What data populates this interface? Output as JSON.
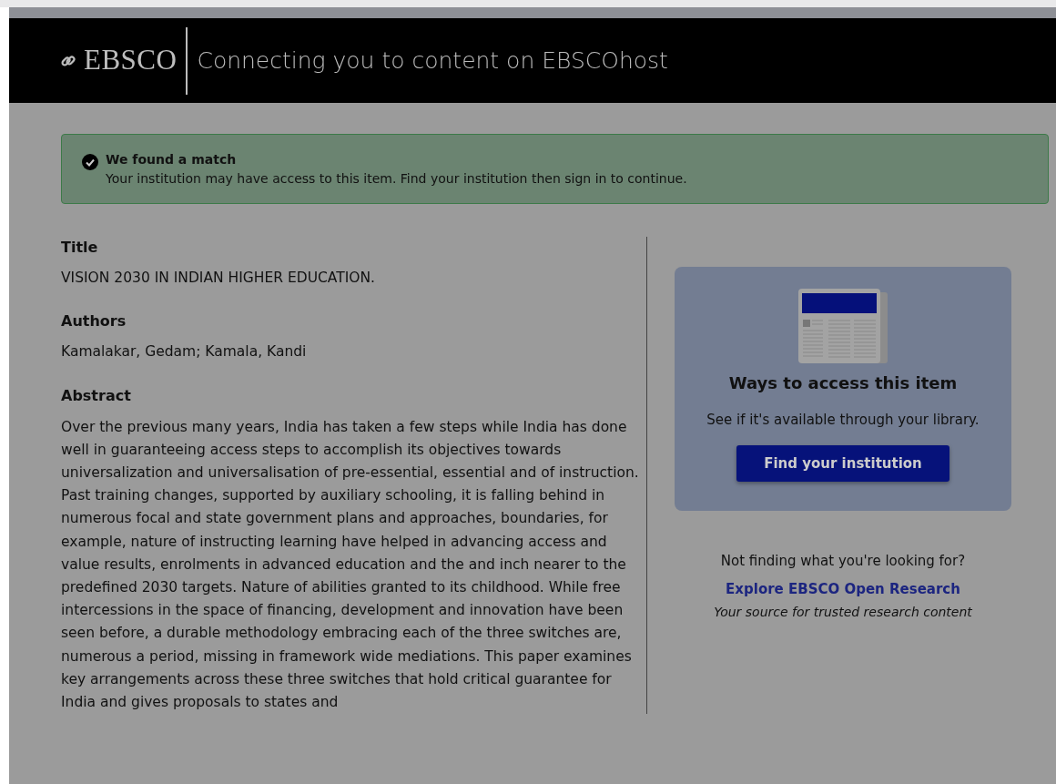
{
  "header": {
    "logo": "EBSCO",
    "title": "Connecting you to content on EBSCOhost"
  },
  "alert": {
    "heading": "We found a match",
    "message": "Your institution may have access to this item. Find your institution then sign in to continue."
  },
  "record": [
    {
      "label": "Title",
      "value": "VISION 2030 IN INDIAN HIGHER EDUCATION."
    },
    {
      "label": "Authors",
      "value": "Kamalakar, Gedam; Kamala, Kandi"
    },
    {
      "label": "Abstract",
      "value": "Over the previous many years, India has taken a few steps while India has done well in guaranteeing access steps to accomplish its objectives towards universalization and universalisation of pre-essential, essential and of instruction. Past training changes, supported by auxiliary schooling, it is falling behind in numerous focal and state government plans and approaches, boundaries, for example, nature of instructing learning have helped in advancing access and value results, enrolments in advanced education and the and inch nearer to the predefined 2030 targets. Nature of abilities granted to its childhood. While free intercessions in the space of financing, development and innovation have been seen before, a durable methodology embracing each of the three switches are, numerous a period, missing in framework wide mediations. This paper examines key arrangements across these three switches that hold critical guarantee for India and gives proposals to states and"
    }
  ],
  "access_card": {
    "heading": "Ways to access this item",
    "text": "See if it's available through your library.",
    "button": "Find your institution"
  },
  "more": {
    "question": "Not finding what you're looking for?",
    "link": "Explore EBSCO Open Research",
    "tagline": "Your source for trusted research content"
  }
}
